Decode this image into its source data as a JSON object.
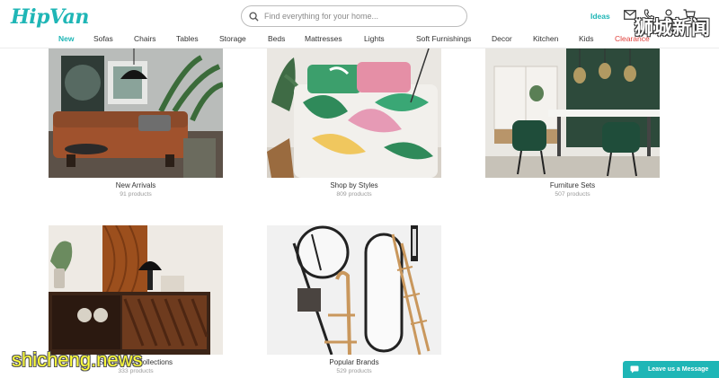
{
  "header": {
    "logo": "HipVan",
    "search_placeholder": "Find everything for your home...",
    "ideas_label": "Ideas",
    "icons": [
      "search-icon",
      "mail-icon",
      "phone-icon",
      "user-icon",
      "cart-icon"
    ]
  },
  "nav": {
    "items": [
      {
        "label": "New",
        "active": true
      },
      {
        "label": "Sofas"
      },
      {
        "label": "Chairs"
      },
      {
        "label": "Tables"
      },
      {
        "label": "Storage"
      },
      {
        "label": "Beds"
      },
      {
        "label": "Mattresses"
      },
      {
        "label": "Lights"
      },
      {
        "label": "Soft Furnishings"
      },
      {
        "label": "Decor"
      },
      {
        "label": "Kitchen"
      },
      {
        "label": "Kids"
      },
      {
        "label": "Clearance"
      }
    ]
  },
  "cards": [
    {
      "title": "New Arrivals",
      "count": "91 products"
    },
    {
      "title": "Shop by Styles",
      "count": "809 products"
    },
    {
      "title": "Furniture Sets",
      "count": "507 products"
    },
    {
      "title": "Solid Wood Collections",
      "count": "333 products"
    },
    {
      "title": "Popular Brands",
      "count": "529 products"
    }
  ],
  "chat": {
    "label": "Leave us a Message"
  },
  "watermarks": {
    "top": "狮城新闻",
    "bottom": "shicheng.news"
  },
  "colors": {
    "brand": "#1fb6b6",
    "clearance": "#e0413c",
    "watermark_bottom": "#ffff3a"
  }
}
